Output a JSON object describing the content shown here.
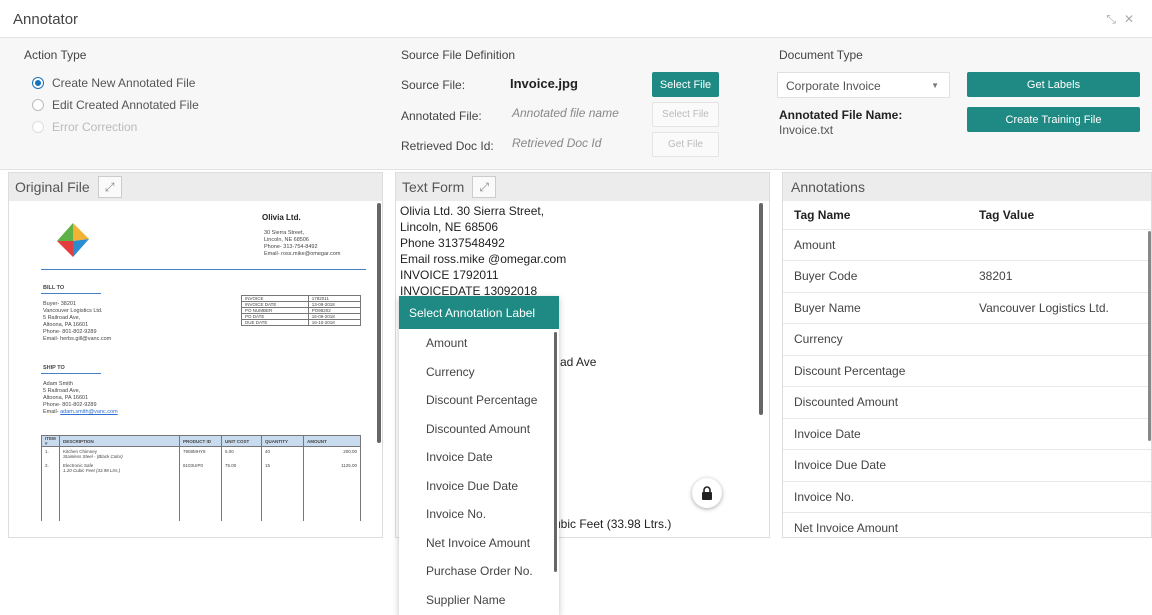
{
  "window": {
    "title": "Annotator",
    "minimize_icon": "collapse-arrows-icon",
    "close_icon": "close-icon"
  },
  "action_type": {
    "heading": "Action Type",
    "options": [
      {
        "label": "Create New Annotated File",
        "checked": true,
        "disabled": false
      },
      {
        "label": "Edit Created Annotated File",
        "checked": false,
        "disabled": false
      },
      {
        "label": "Error Correction",
        "checked": false,
        "disabled": true
      }
    ]
  },
  "source_file": {
    "heading": "Source File Definition",
    "source_label": "Source File:",
    "source_value": "Invoice.jpg",
    "select_file": "Select File",
    "annotated_label": "Annotated File:",
    "annotated_placeholder": "Annotated file name",
    "select_file_disabled": "Select File",
    "retrieved_label": "Retrieved Doc Id:",
    "retrieved_placeholder": "Retrieved Doc Id",
    "get_file": "Get File"
  },
  "document_type": {
    "heading": "Document Type",
    "selected": "Corporate Invoice",
    "get_labels": "Get Labels",
    "annotated_name_label": "Annotated File Name:",
    "annotated_name_value": "Invoice.txt",
    "create_training": "Create Training File"
  },
  "original_file": {
    "title": "Original File",
    "invoice": {
      "company": "Olivia Ltd.",
      "address": [
        "30 Sierra Street,",
        "Lincoln, NE 68506",
        "Phone- 313-754-8492",
        "Email- ross.mike@omegar.com"
      ],
      "bill_to_h": "BILL TO",
      "bill_to": [
        "Buyer- 38201",
        "Vancouver Logistics Ltd.",
        "5 Railroad Ave,",
        "Altoona, PA 16601",
        "Phone- 801-802-9289",
        "Email- herbs.gill@vanc.com"
      ],
      "meta": [
        [
          "INVOICE",
          "1792011"
        ],
        [
          "INVOICE DATE",
          "13-09-2018"
        ],
        [
          "PO NUMBER",
          "PO98202"
        ],
        [
          "PO DATE",
          "16-09-2018"
        ],
        [
          "DUE DATE",
          "16-10-2018"
        ]
      ],
      "ship_to_h": "SHIP TO",
      "ship_to": [
        "Adam Smith",
        "5 Railroad Ave,",
        "Altoona, PA 16601",
        "Phone- 801-802-9289"
      ],
      "ship_email_label": "Email-",
      "ship_email": "adam.smith@vanc.com",
      "items_header": [
        "ITEM #",
        "DESCRIPTION",
        "PRODUCT ID",
        "UNIT COST",
        "QUANTITY",
        "AMOUNT"
      ],
      "items": [
        {
          "no": "1.",
          "desc": "Kitchen Chimney",
          "sub": "Stainless Steel - (Black Color)",
          "pid": "7908MHY8",
          "cost": "5.00",
          "qty": "40",
          "amount": "200.00"
        },
        {
          "no": "2.",
          "desc": "Electronic Safe",
          "sub": "1.20 Cubic Feet (33.98 Ltrs.)",
          "pid": "8103UIP0",
          "cost": "75.00",
          "qty": "15",
          "amount": "1125.00"
        }
      ]
    }
  },
  "text_form": {
    "title": "Text Form",
    "lines": [
      "Olivia Ltd. 30 Sierra Street,",
      "Lincoln, NE 68506",
      "Phone 3137548492",
      "Email ross.mike @omegar.com",
      "INVOICE 1792011",
      "INVOICEDATE 13092018"
    ],
    "partial_1": "ad Ave",
    "partial_2": "ubic Feet (33.98 Ltrs.)",
    "lock_icon": "lock-icon"
  },
  "annotation_dropdown": {
    "heading": "Select Annotation Label",
    "items": [
      "Amount",
      "Currency",
      "Discount Percentage",
      "Discounted Amount",
      "Invoice Date",
      "Invoice Due Date",
      "Invoice No.",
      "Net Invoice Amount",
      "Purchase Order No.",
      "Supplier Name"
    ]
  },
  "annotations": {
    "title": "Annotations",
    "col_name": "Tag Name",
    "col_value": "Tag Value",
    "rows": [
      {
        "name": "Amount",
        "value": ""
      },
      {
        "name": "Buyer Code",
        "value": "38201"
      },
      {
        "name": "Buyer Name",
        "value": "Vancouver Logistics Ltd."
      },
      {
        "name": "Currency",
        "value": ""
      },
      {
        "name": "Discount Percentage",
        "value": ""
      },
      {
        "name": "Discounted Amount",
        "value": ""
      },
      {
        "name": "Invoice Date",
        "value": ""
      },
      {
        "name": "Invoice Due Date",
        "value": ""
      },
      {
        "name": "Invoice No.",
        "value": ""
      },
      {
        "name": "Net Invoice Amount",
        "value": ""
      }
    ]
  },
  "colors": {
    "teal": "#1f8a84",
    "radio": "#1a73b8",
    "header_bg": "#ececec",
    "table_header": "#c9dcef"
  }
}
